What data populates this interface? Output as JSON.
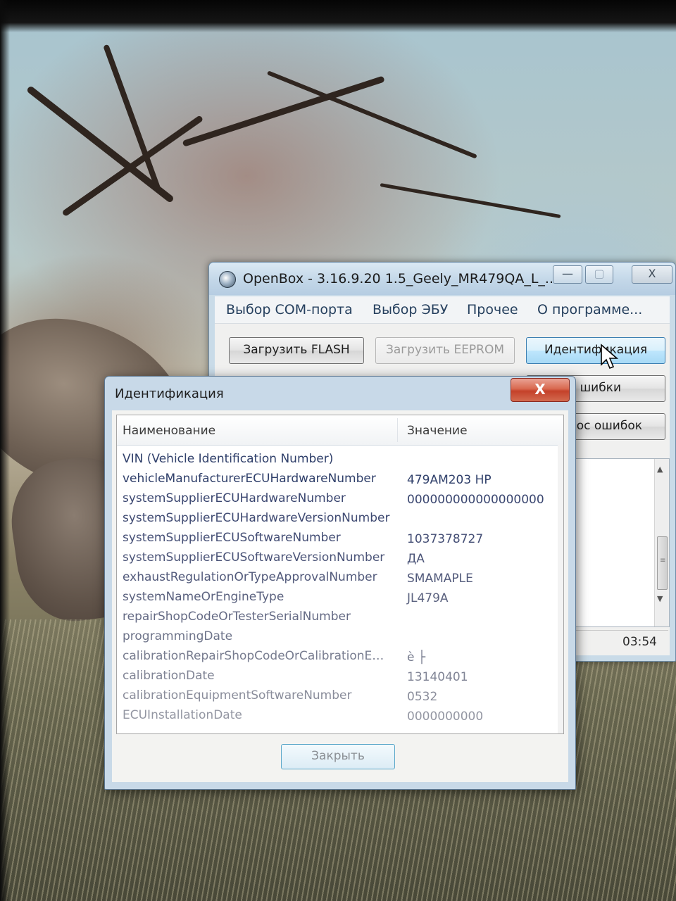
{
  "main_window": {
    "title": "OpenBox - 3.16.9.20 1.5_Geely_MR479QA_L_...",
    "caption_buttons": {
      "minimize": "—",
      "maximize": "▢",
      "close": "X"
    },
    "menu": [
      "Выбор COM-порта",
      "Выбор ЭБУ",
      "Прочее",
      "О программе..."
    ],
    "buttons": {
      "load_flash": "Загрузить FLASH",
      "load_eeprom": "Загрузить EEPROM",
      "identification": "Идентификация",
      "errors_partial": "шибки",
      "reset_errors_partial": "ос ошибок"
    },
    "status_time": "03:54"
  },
  "dialog": {
    "title": "Идентификация",
    "close_x": "X",
    "columns": {
      "name": "Наименование",
      "value": "Значение"
    },
    "rows": [
      {
        "name": "VIN (Vehicle Identification Number)",
        "value": ""
      },
      {
        "name": "vehicleManufacturerECUHardwareNumber",
        "value": "479AM203 HP"
      },
      {
        "name": "systemSupplierECUHardwareNumber",
        "value": "000000000000000000"
      },
      {
        "name": "systemSupplierECUHardwareVersionNumber",
        "value": ""
      },
      {
        "name": "systemSupplierECUSoftwareNumber",
        "value": "1037378727"
      },
      {
        "name": "systemSupplierECUSoftwareVersionNumber",
        "value": "ДА"
      },
      {
        "name": "exhaustRegulationOrTypeApprovalNumber",
        "value": "SMAMAPLE"
      },
      {
        "name": "systemNameOrEngineType",
        "value": "JL479A"
      },
      {
        "name": "repairShopCodeOrTesterSerialNumber",
        "value": ""
      },
      {
        "name": "programmingDate",
        "value": ""
      },
      {
        "name": "calibrationRepairShopCodeOrCalibrationEqui...",
        "value": "è ├"
      },
      {
        "name": "calibrationDate",
        "value": "13140401"
      },
      {
        "name": "calibrationEquipmentSoftwareNumber",
        "value": "0532"
      },
      {
        "name": "ECUInstallationDate",
        "value": "0000000000"
      }
    ],
    "close_button": "Закрыть"
  }
}
